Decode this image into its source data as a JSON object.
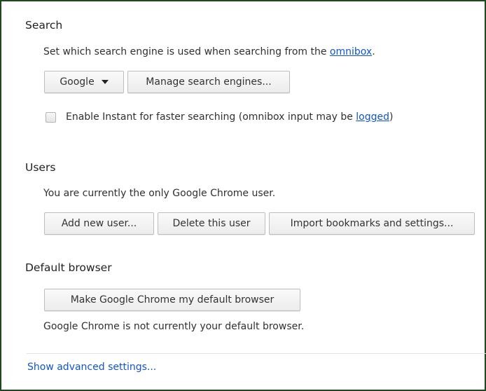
{
  "search": {
    "title": "Search",
    "description_before_link": "Set which search engine is used when searching from the ",
    "description_link": "omnibox",
    "description_after_link": ".",
    "engine_select": "Google",
    "manage_button": "Manage search engines...",
    "instant_label_before_link": "Enable Instant for faster searching (omnibox input may be ",
    "instant_link": "logged",
    "instant_label_after_link": ")",
    "instant_checked": false
  },
  "users": {
    "title": "Users",
    "description": "You are currently the only Google Chrome user.",
    "add_button": "Add new user...",
    "delete_button": "Delete this user",
    "import_button": "Import bookmarks and settings..."
  },
  "default_browser": {
    "title": "Default browser",
    "make_default_button": "Make Google Chrome my default browser",
    "status": "Google Chrome is not currently your default browser."
  },
  "footer": {
    "advanced_link": "Show advanced settings..."
  },
  "colors": {
    "link": "#1155cc",
    "frame_border": "#1c4a1c"
  }
}
